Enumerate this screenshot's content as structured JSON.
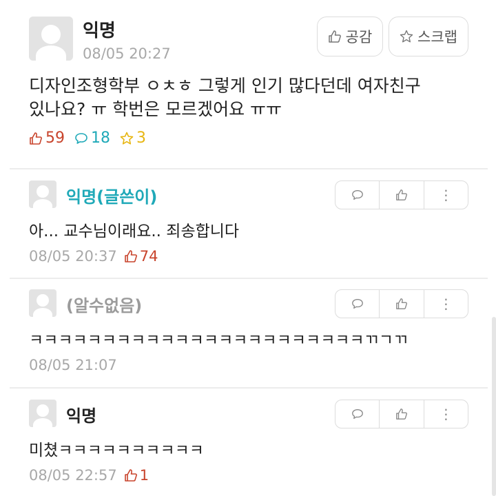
{
  "post": {
    "author": "익명",
    "date": "08/05 20:27",
    "like_button": "공감",
    "scrap_button": "스크랩",
    "lines": [
      "디자인조형학부 ㅇㅊㅎ 그렇게 인기 많다던데 여자친구",
      "있나요? ㅠ 학번은 모르겠어요 ㅠㅠ"
    ],
    "stats": {
      "likes": "59",
      "comments": "18",
      "scraps": "3"
    }
  },
  "colors": {
    "like": "#c8432b",
    "comment": "#1fa9b8",
    "scrap": "#e7b612",
    "writer": "#1fa9b8",
    "unknown": "#9b9b9b"
  },
  "comments": [
    {
      "author": "익명(글쓴이)",
      "text": "아... 교수님이래요.. 죄송합니다",
      "date": "08/05 20:37",
      "likes": "74"
    },
    {
      "author": "(알수없음)",
      "text": "ㅋㅋㅋㅋㅋㅋㅋㅋㅋㅋㅋㅋㅋㅋㅋㅋㅋㅋㅋㅋㅋㅋㅋㄲㄱㄲ",
      "date": "08/05 21:07"
    },
    {
      "author": "익명",
      "text": "미쳤ㅋㅋㅋㅋㅋㅋㅋㅋㅋㅋ",
      "date": "08/05 22:57",
      "likes": "1"
    }
  ]
}
